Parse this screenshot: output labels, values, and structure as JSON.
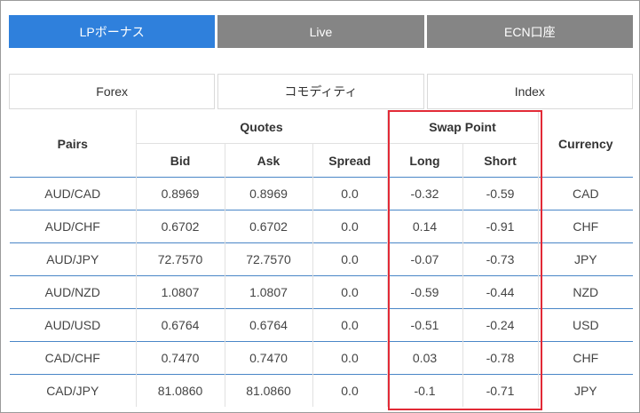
{
  "account_tabs": [
    {
      "label": "LPボーナス",
      "active": true
    },
    {
      "label": "Live",
      "active": false
    },
    {
      "label": "ECN口座",
      "active": false
    }
  ],
  "category_tabs": [
    {
      "label": "Forex"
    },
    {
      "label": "コモディティ"
    },
    {
      "label": "Index"
    }
  ],
  "table": {
    "headers": {
      "pairs": "Pairs",
      "quotes": "Quotes",
      "swap_point": "Swap Point",
      "currency": "Currency",
      "bid": "Bid",
      "ask": "Ask",
      "spread": "Spread",
      "long": "Long",
      "short": "Short"
    },
    "rows": [
      {
        "pair": "AUD/CAD",
        "bid": "0.8969",
        "ask": "0.8969",
        "spread": "0.0",
        "long": "-0.32",
        "short": "-0.59",
        "currency": "CAD"
      },
      {
        "pair": "AUD/CHF",
        "bid": "0.6702",
        "ask": "0.6702",
        "spread": "0.0",
        "long": "0.14",
        "short": "-0.91",
        "currency": "CHF"
      },
      {
        "pair": "AUD/JPY",
        "bid": "72.7570",
        "ask": "72.7570",
        "spread": "0.0",
        "long": "-0.07",
        "short": "-0.73",
        "currency": "JPY"
      },
      {
        "pair": "AUD/NZD",
        "bid": "1.0807",
        "ask": "1.0807",
        "spread": "0.0",
        "long": "-0.59",
        "short": "-0.44",
        "currency": "NZD"
      },
      {
        "pair": "AUD/USD",
        "bid": "0.6764",
        "ask": "0.6764",
        "spread": "0.0",
        "long": "-0.51",
        "short": "-0.24",
        "currency": "USD"
      },
      {
        "pair": "CAD/CHF",
        "bid": "0.7470",
        "ask": "0.7470",
        "spread": "0.0",
        "long": "0.03",
        "short": "-0.78",
        "currency": "CHF"
      },
      {
        "pair": "CAD/JPY",
        "bid": "81.0860",
        "ask": "81.0860",
        "spread": "0.0",
        "long": "-0.1",
        "short": "-0.71",
        "currency": "JPY"
      }
    ]
  },
  "colors": {
    "active_tab": "#2f80dc",
    "inactive_tab": "#858585",
    "highlight": "#e22a36",
    "row_divider": "#4a86c7"
  }
}
